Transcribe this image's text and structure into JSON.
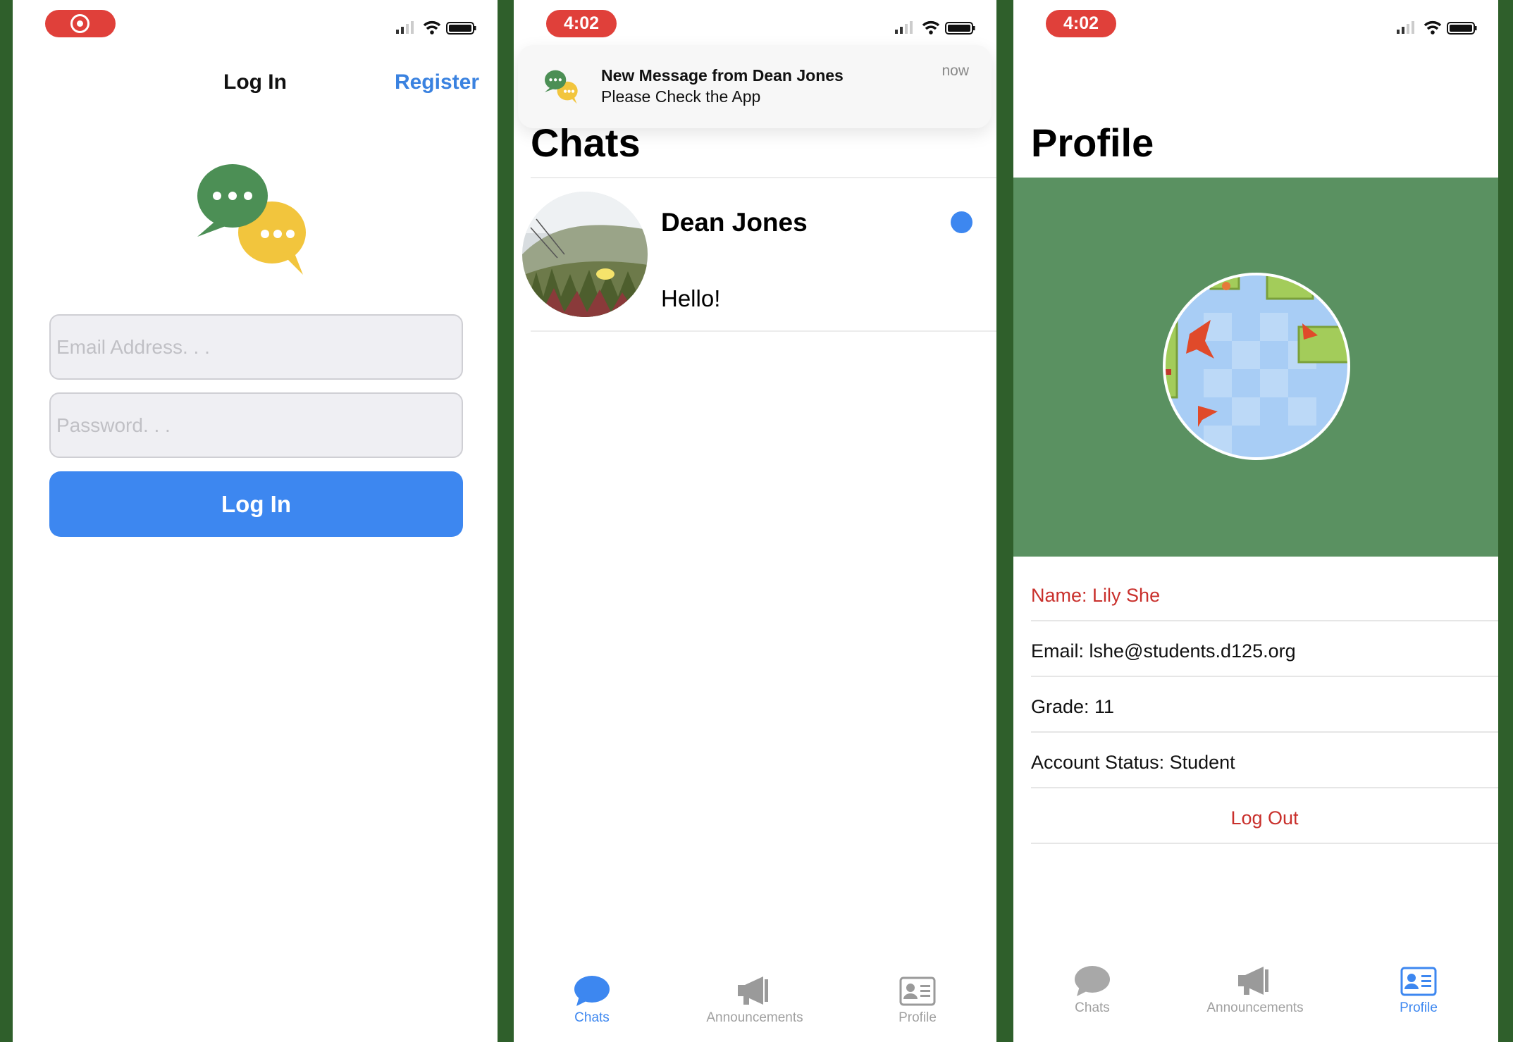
{
  "colors": {
    "background": "#2f5f2b",
    "accent_blue": "#3d87f0",
    "record_red": "#e0403a",
    "profile_green": "#5a9161",
    "destructive_red": "#c9302c",
    "tab_inactive": "#a0a0a0"
  },
  "login_screen": {
    "status": {
      "indicator": "record-icon"
    },
    "nav_title": "Log In",
    "register_link": "Register",
    "email_placeholder": "Email Address. . .",
    "password_placeholder": "Password. . .",
    "login_button": "Log In"
  },
  "chats_screen": {
    "status": {
      "time": "4:02"
    },
    "notification": {
      "title": "New Message from Dean Jones",
      "body": "Please Check the App",
      "time": "now"
    },
    "title": "Chats",
    "chat_list": [
      {
        "name": "Dean Jones",
        "preview": "Hello!",
        "unread": true
      }
    ],
    "tab_bar": [
      {
        "label": "Chats",
        "icon": "chat-bubble-icon",
        "active": true
      },
      {
        "label": "Announcements",
        "icon": "megaphone-icon",
        "active": false
      },
      {
        "label": "Profile",
        "icon": "contact-card-icon",
        "active": false
      }
    ]
  },
  "profile_screen": {
    "status": {
      "time": "4:02"
    },
    "title": "Profile",
    "name_row": "Name: Lily She",
    "email_row": "Email: lshe@students.d125.org",
    "grade_row": "Grade: 11",
    "status_row": "Account Status: Student",
    "logout": "Log Out",
    "tab_bar": [
      {
        "label": "Chats",
        "icon": "chat-bubble-icon",
        "active": false
      },
      {
        "label": "Announcements",
        "icon": "megaphone-icon",
        "active": false
      },
      {
        "label": "Profile",
        "icon": "contact-card-icon",
        "active": true
      }
    ]
  }
}
